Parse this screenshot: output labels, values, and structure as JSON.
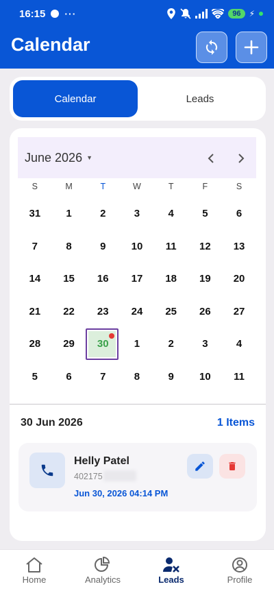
{
  "status_bar": {
    "time": "16:15",
    "more": "···",
    "battery": "96",
    "bolt": "⚡"
  },
  "header": {
    "title": "Calendar"
  },
  "tabs": [
    {
      "label": "Calendar",
      "active": true
    },
    {
      "label": "Leads",
      "active": false
    }
  ],
  "calendar": {
    "month_label": "June 2026",
    "weekdays": [
      "S",
      "M",
      "T",
      "W",
      "T",
      "F",
      "S"
    ],
    "weeks": [
      [
        "31",
        "1",
        "2",
        "3",
        "4",
        "5",
        "6"
      ],
      [
        "7",
        "8",
        "9",
        "10",
        "11",
        "12",
        "13"
      ],
      [
        "14",
        "15",
        "16",
        "17",
        "18",
        "19",
        "20"
      ],
      [
        "21",
        "22",
        "23",
        "24",
        "25",
        "26",
        "27"
      ],
      [
        "28",
        "29",
        "30",
        "1",
        "2",
        "3",
        "4"
      ],
      [
        "5",
        "6",
        "7",
        "8",
        "9",
        "10",
        "11"
      ]
    ],
    "selected_day": "30"
  },
  "agenda": {
    "date": "30 Jun 2026",
    "count_label": "1 Items",
    "items": [
      {
        "name": "Helly Patel",
        "number": "402175",
        "datetime": "Jun 30, 2026 04:14 PM"
      }
    ]
  },
  "bottom_nav": [
    {
      "label": "Home",
      "icon": "home-icon"
    },
    {
      "label": "Analytics",
      "icon": "analytics-icon"
    },
    {
      "label": "Leads",
      "icon": "leads-icon",
      "active": true
    },
    {
      "label": "Profile",
      "icon": "profile-icon"
    }
  ],
  "colors": {
    "primary": "#0956d6",
    "event_dot": "#e53935",
    "selected_text": "#3aa14a",
    "delete": "#e53935"
  }
}
